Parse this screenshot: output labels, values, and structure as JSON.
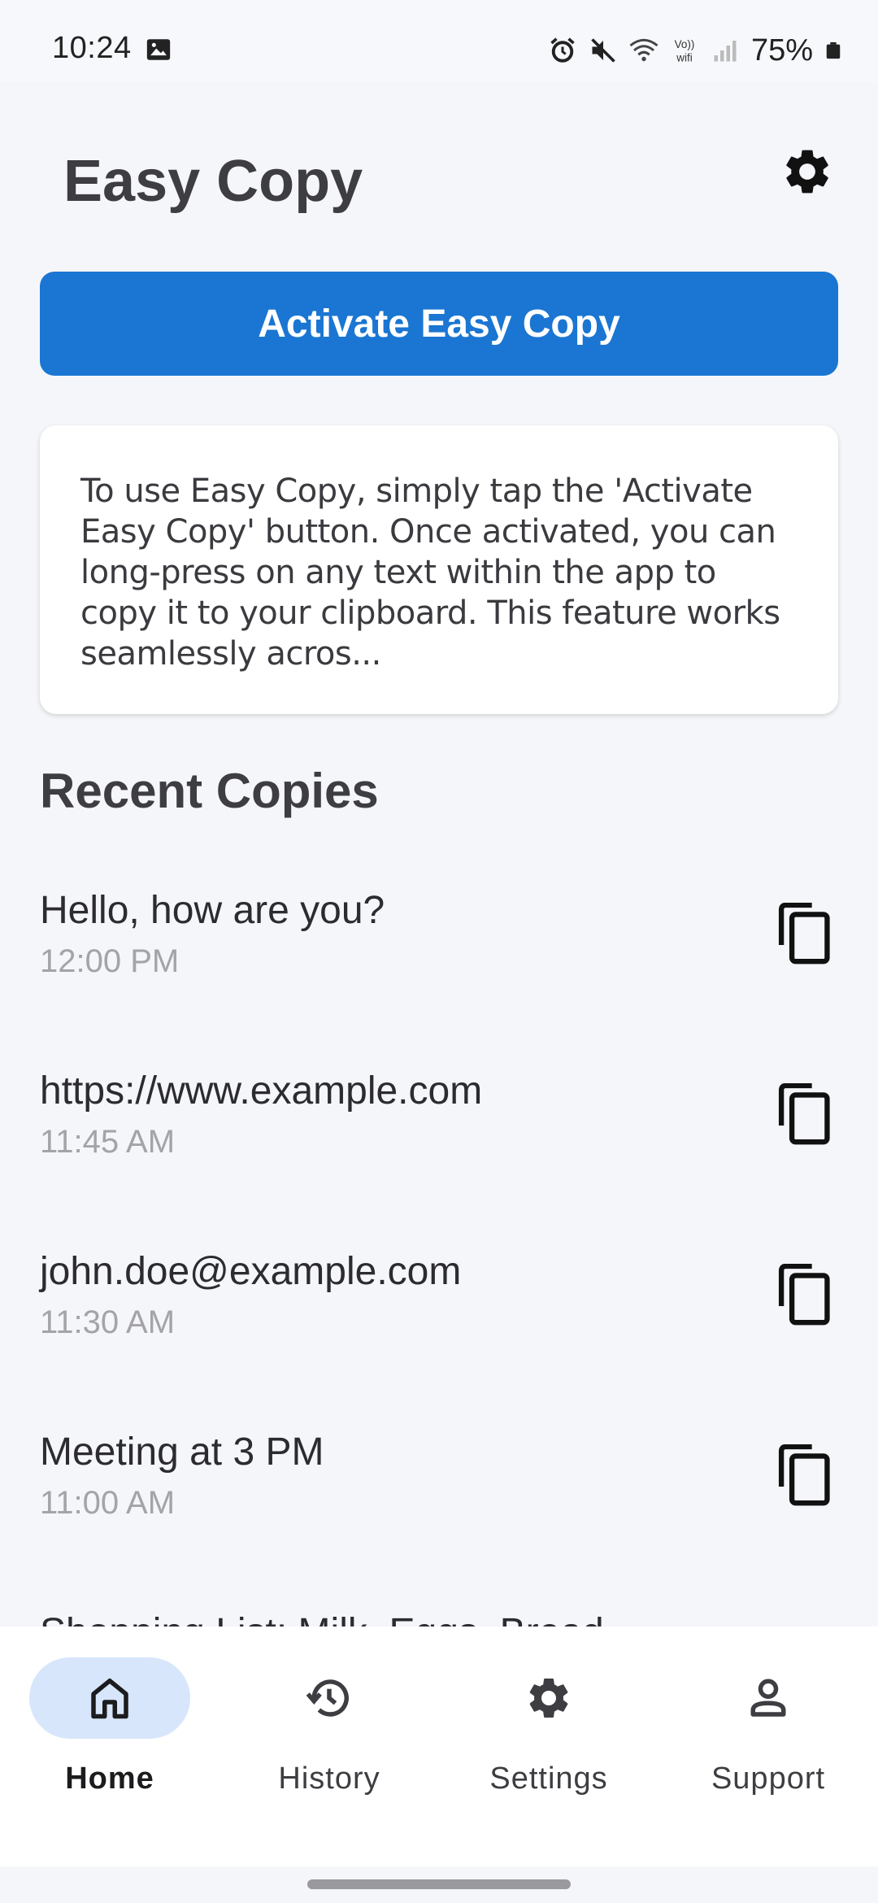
{
  "status_bar": {
    "time": "10:24",
    "battery": "75%",
    "icons": [
      "image-icon",
      "alarm-icon",
      "mute-icon",
      "wifi-icon",
      "volte-wifi-icon",
      "signal-icon",
      "battery-icon"
    ]
  },
  "header": {
    "title": "Easy Copy",
    "settings_icon": "gear-icon"
  },
  "activate_button": {
    "label": "Activate Easy Copy",
    "color": "#1a76d2"
  },
  "info_card": {
    "text": "To use Easy Copy, simply tap the 'Activate Easy Copy' button. Once activated, you can long-press on any text within the app to copy it to your clipboard. This feature works seamlessly acros..."
  },
  "recent": {
    "title": "Recent Copies",
    "items": [
      {
        "text": "Hello, how are you?",
        "time": "12:00 PM"
      },
      {
        "text": "https://www.example.com",
        "time": "11:45 AM"
      },
      {
        "text": "john.doe@example.com",
        "time": "11:30 AM"
      },
      {
        "text": "Meeting at 3 PM",
        "time": "11:00 AM"
      },
      {
        "text": "Shopping List: Milk, Eggs, Bread",
        "time": ""
      }
    ]
  },
  "bottom_nav": {
    "active_color": "#d7e6fb",
    "items": [
      {
        "label": "Home",
        "icon": "home-icon",
        "active": true
      },
      {
        "label": "History",
        "icon": "history-icon",
        "active": false
      },
      {
        "label": "Settings",
        "icon": "gear-icon",
        "active": false
      },
      {
        "label": "Support",
        "icon": "person-icon",
        "active": false
      }
    ]
  }
}
